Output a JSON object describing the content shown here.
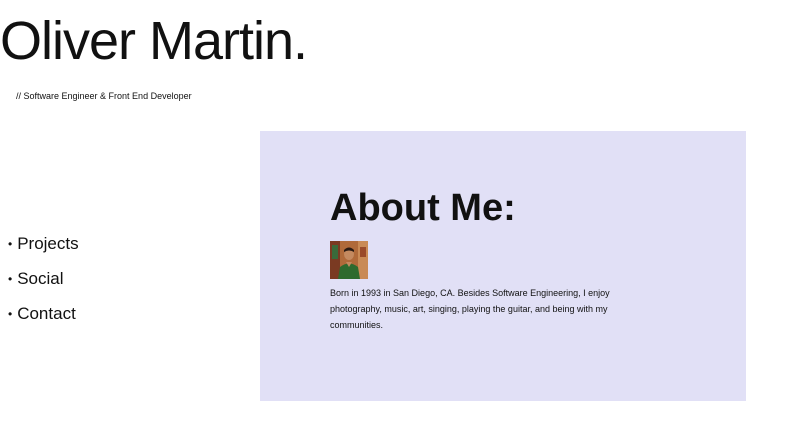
{
  "header": {
    "name": "Oliver Martin.",
    "tagline": "// Software Engineer & Front End Developer"
  },
  "nav": {
    "bullet": "•",
    "items": [
      {
        "label": "Projects"
      },
      {
        "label": "Social"
      },
      {
        "label": "Contact"
      }
    ]
  },
  "about": {
    "heading": "About Me:",
    "bio": "Born in 1993 in San Diego, CA. Besides Software Engineering, I enjoy photography, music, art, singing, playing the guitar, and being with my communities."
  },
  "colors": {
    "about_background": "#e1e0f6",
    "text": "#111111"
  },
  "icons": {
    "avatar": "profile-photo"
  }
}
